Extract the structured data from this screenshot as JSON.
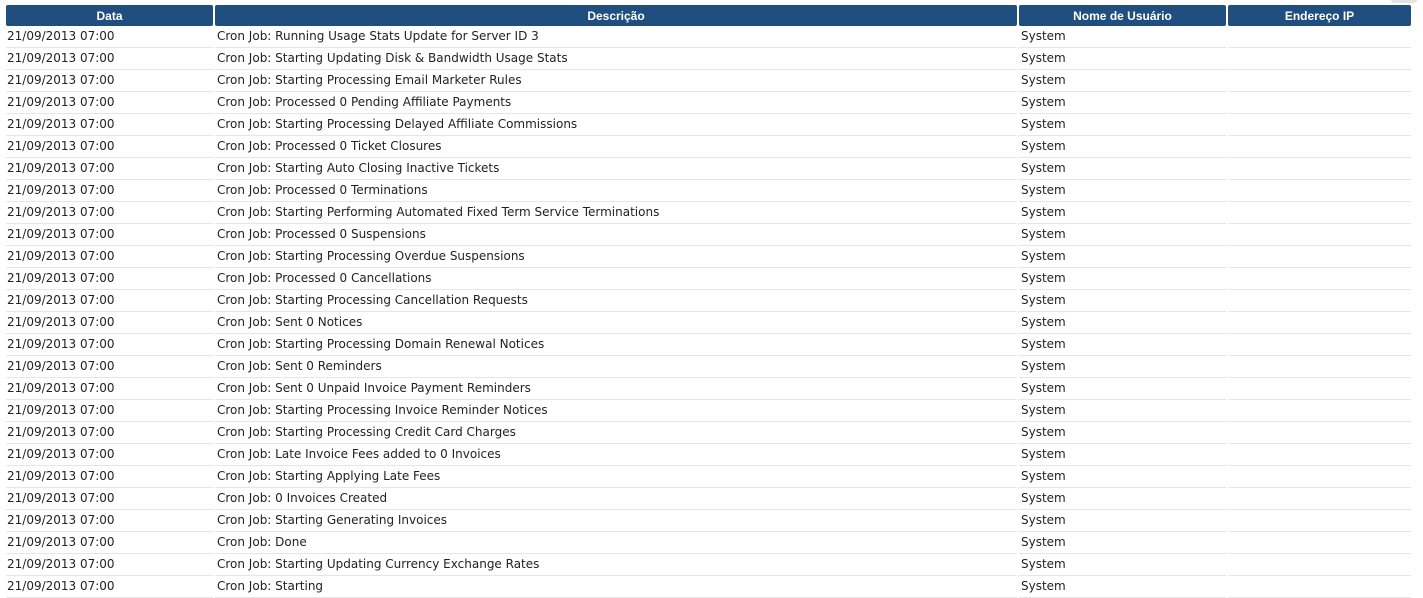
{
  "table": {
    "headers": {
      "date": "Data",
      "description": "Descrição",
      "username": "Nome de Usuário",
      "ip": "Endereço IP"
    },
    "rows": [
      {
        "date": "21/09/2013 07:00",
        "description": "Cron Job: Running Usage Stats Update for Server ID 3",
        "username": "System",
        "ip": ""
      },
      {
        "date": "21/09/2013 07:00",
        "description": "Cron Job: Starting Updating Disk & Bandwidth Usage Stats",
        "username": "System",
        "ip": ""
      },
      {
        "date": "21/09/2013 07:00",
        "description": "Cron Job: Starting Processing Email Marketer Rules",
        "username": "System",
        "ip": ""
      },
      {
        "date": "21/09/2013 07:00",
        "description": "Cron Job: Processed 0 Pending Affiliate Payments",
        "username": "System",
        "ip": ""
      },
      {
        "date": "21/09/2013 07:00",
        "description": "Cron Job: Starting Processing Delayed Affiliate Commissions",
        "username": "System",
        "ip": ""
      },
      {
        "date": "21/09/2013 07:00",
        "description": "Cron Job: Processed 0 Ticket Closures",
        "username": "System",
        "ip": ""
      },
      {
        "date": "21/09/2013 07:00",
        "description": "Cron Job: Starting Auto Closing Inactive Tickets",
        "username": "System",
        "ip": ""
      },
      {
        "date": "21/09/2013 07:00",
        "description": "Cron Job: Processed 0 Terminations",
        "username": "System",
        "ip": ""
      },
      {
        "date": "21/09/2013 07:00",
        "description": "Cron Job: Starting Performing Automated Fixed Term Service Terminations",
        "username": "System",
        "ip": ""
      },
      {
        "date": "21/09/2013 07:00",
        "description": "Cron Job: Processed 0 Suspensions",
        "username": "System",
        "ip": ""
      },
      {
        "date": "21/09/2013 07:00",
        "description": "Cron Job: Starting Processing Overdue Suspensions",
        "username": "System",
        "ip": ""
      },
      {
        "date": "21/09/2013 07:00",
        "description": "Cron Job: Processed 0 Cancellations",
        "username": "System",
        "ip": ""
      },
      {
        "date": "21/09/2013 07:00",
        "description": "Cron Job: Starting Processing Cancellation Requests",
        "username": "System",
        "ip": ""
      },
      {
        "date": "21/09/2013 07:00",
        "description": "Cron Job: Sent 0 Notices",
        "username": "System",
        "ip": ""
      },
      {
        "date": "21/09/2013 07:00",
        "description": "Cron Job: Starting Processing Domain Renewal Notices",
        "username": "System",
        "ip": ""
      },
      {
        "date": "21/09/2013 07:00",
        "description": "Cron Job: Sent 0 Reminders",
        "username": "System",
        "ip": ""
      },
      {
        "date": "21/09/2013 07:00",
        "description": "Cron Job: Sent 0 Unpaid Invoice Payment Reminders",
        "username": "System",
        "ip": ""
      },
      {
        "date": "21/09/2013 07:00",
        "description": "Cron Job: Starting Processing Invoice Reminder Notices",
        "username": "System",
        "ip": ""
      },
      {
        "date": "21/09/2013 07:00",
        "description": "Cron Job: Starting Processing Credit Card Charges",
        "username": "System",
        "ip": ""
      },
      {
        "date": "21/09/2013 07:00",
        "description": "Cron Job: Late Invoice Fees added to 0 Invoices",
        "username": "System",
        "ip": ""
      },
      {
        "date": "21/09/2013 07:00",
        "description": "Cron Job: Starting Applying Late Fees",
        "username": "System",
        "ip": ""
      },
      {
        "date": "21/09/2013 07:00",
        "description": "Cron Job: 0 Invoices Created",
        "username": "System",
        "ip": ""
      },
      {
        "date": "21/09/2013 07:00",
        "description": "Cron Job: Starting Generating Invoices",
        "username": "System",
        "ip": ""
      },
      {
        "date": "21/09/2013 07:00",
        "description": "Cron Job: Done",
        "username": "System",
        "ip": ""
      },
      {
        "date": "21/09/2013 07:00",
        "description": "Cron Job: Starting Updating Currency Exchange Rates",
        "username": "System",
        "ip": ""
      },
      {
        "date": "21/09/2013 07:00",
        "description": "Cron Job: Starting",
        "username": "System",
        "ip": ""
      }
    ]
  }
}
